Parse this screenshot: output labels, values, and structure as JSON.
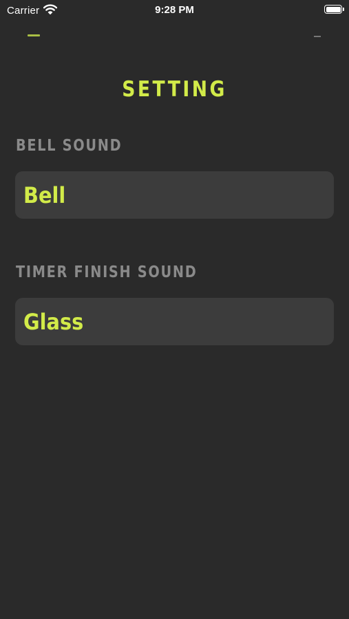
{
  "status_bar": {
    "carrier": "Carrier",
    "time": "9:28 PM",
    "wifi_icon": "wifi-icon",
    "battery_icon": "battery-icon"
  },
  "page": {
    "title": "SETTING"
  },
  "bell_sound": {
    "label": "BELL SOUND",
    "value": "Bell"
  },
  "timer_finish_sound": {
    "label": "TIMER FINISH SOUND",
    "value": "Glass"
  },
  "colors": {
    "background": "#2a2a2a",
    "accent": "#d2eb49",
    "label_gray": "#8a8a8a",
    "field_background": "#3c3c3c"
  }
}
